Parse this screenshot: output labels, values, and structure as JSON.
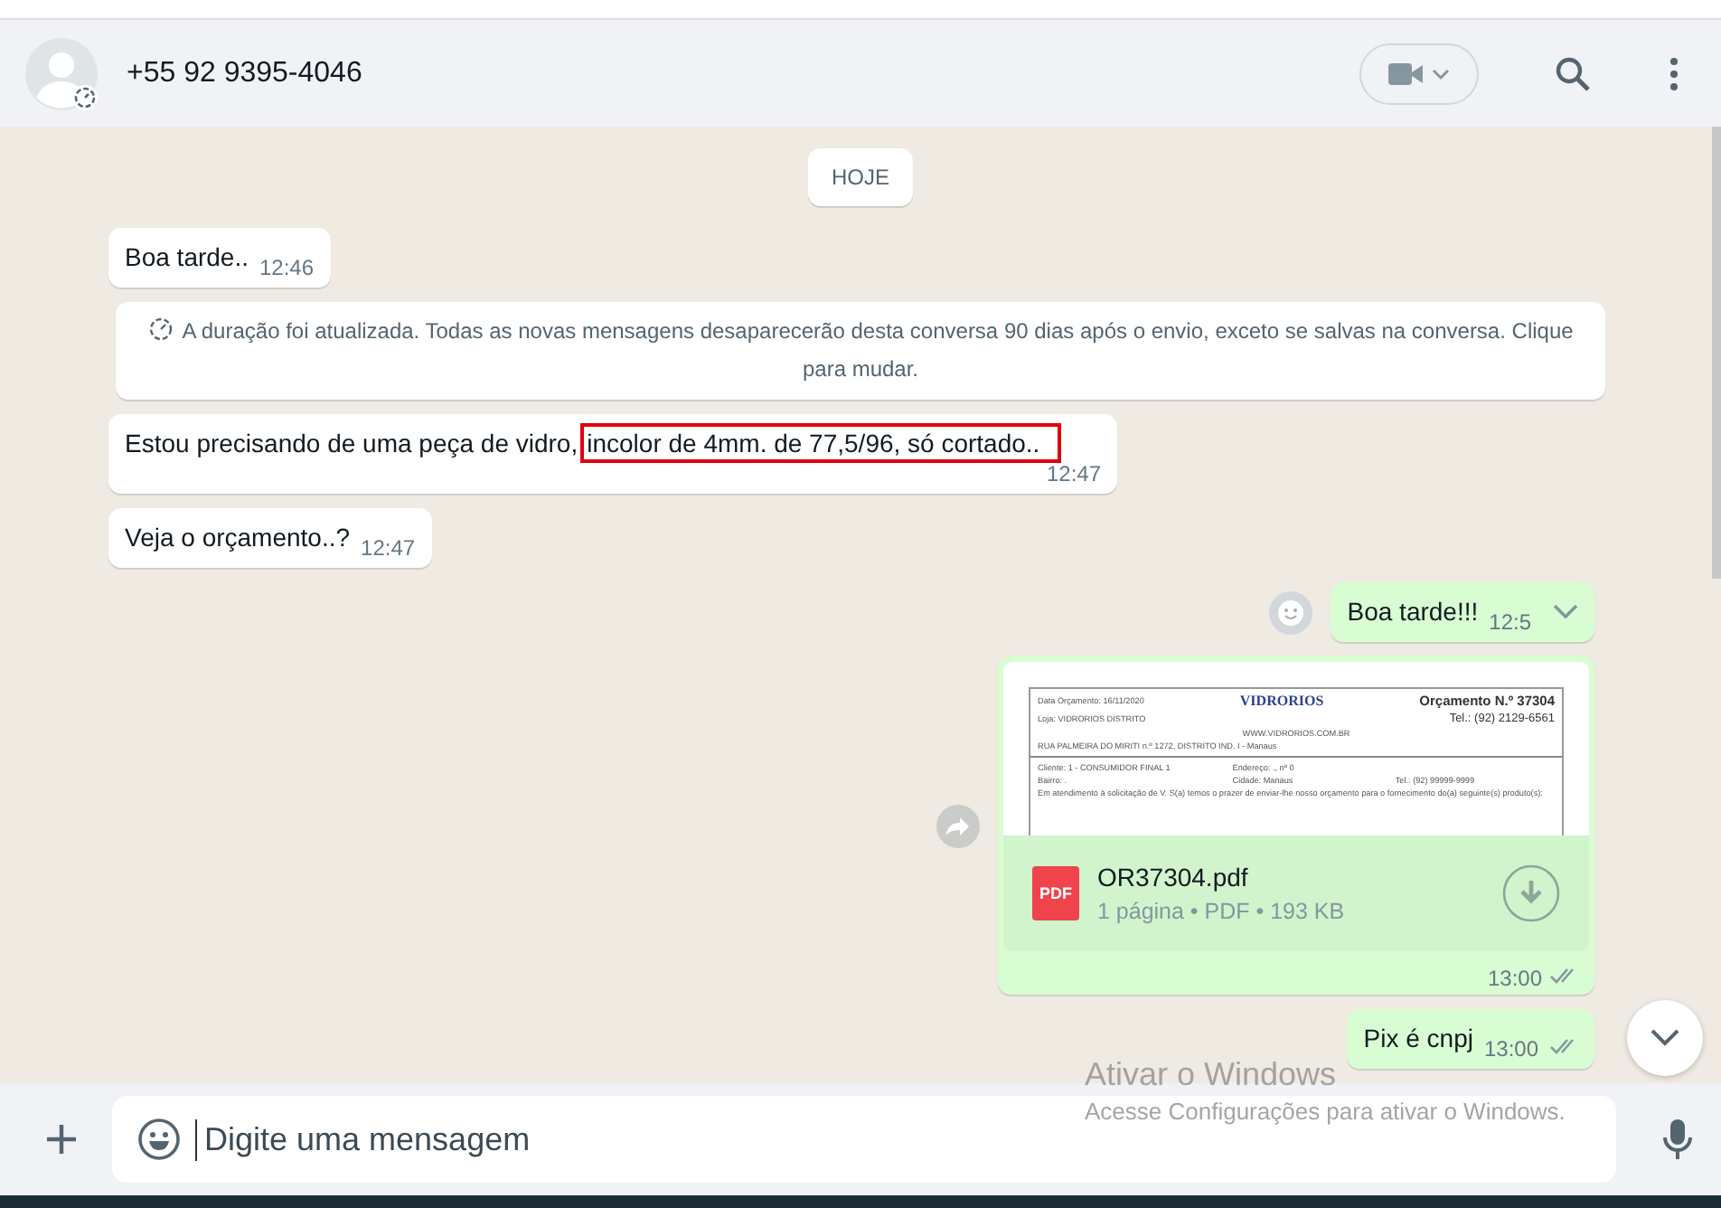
{
  "header": {
    "contact": "+55 92 9395-4046"
  },
  "date_chip": "HOJE",
  "messages": [
    {
      "kind": "in",
      "text": "Boa tarde..",
      "time": "12:46"
    },
    {
      "kind": "system",
      "text": "A duração foi atualizada. Todas as novas mensagens desaparecerão desta conversa 90 dias após o envio, exceto se salvas na conversa. Clique para mudar."
    },
    {
      "kind": "in",
      "text": "Estou precisando de uma peça de vidro,",
      "highlighted": "incolor de 4mm. de 77,5/96, só cortado..",
      "time": "12:47"
    },
    {
      "kind": "in",
      "text": "Veja o orçamento..?",
      "time": "12:47"
    },
    {
      "kind": "out",
      "text": "Boa tarde!!!",
      "time": "12:5",
      "hovered": true
    },
    {
      "kind": "document",
      "file_name": "OR37304.pdf",
      "file_type": "PDF",
      "file_info": "1 página • PDF • 193 KB",
      "time": "13:00",
      "read": false,
      "preview": {
        "date": "Data Orçamento: 16/11/2020",
        "brand": "VIDRORIOS",
        "number": "Orçamento N.º 37304",
        "store": "Loja: VIDRORIOS DISTRITO",
        "phone": "Tel.: (92) 2129-6561",
        "site": "WWW.VIDRORIOS.COM.BR",
        "address": "RUA PALMEIRA DO MIRITI n.º 1272, DISTRITO IND. I - Manaus",
        "client": "Cliente: 1 - CONSUMIDOR FINAL 1",
        "street": "Endereço: ., nº 0",
        "district": "Bairro: .",
        "city": "Cidade: Manaus",
        "client_phone": "Tel.: (92) 99999-9999",
        "intro": "Em atendimento à solicitação de V. S(a) temos o prazer de enviar-lhe nosso orçamento para o fornecimento do(a) seguinte(s) produto(s):"
      }
    },
    {
      "kind": "out",
      "text": "Pix é cnpj",
      "time": "13:00",
      "read": false
    }
  ],
  "composer": {
    "placeholder": "Digite uma mensagem"
  },
  "activation_notice": {
    "title": "Ativar o Windows",
    "subtitle": "Acesse Configurações para ativar o Windows."
  }
}
